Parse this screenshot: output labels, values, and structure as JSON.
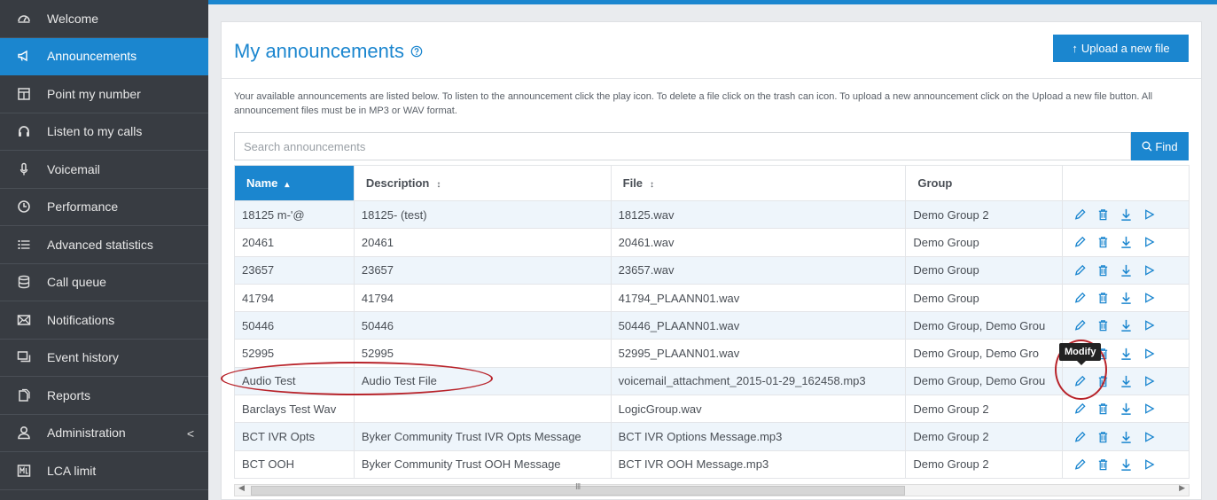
{
  "sidebar": {
    "items": [
      {
        "label": "Welcome",
        "icon": "dashboard-icon"
      },
      {
        "label": "Announcements",
        "icon": "megaphone-icon",
        "active": true
      },
      {
        "label": "Point my number",
        "icon": "layout-icon"
      },
      {
        "label": "Listen to my calls",
        "icon": "headset-icon"
      },
      {
        "label": "Voicemail",
        "icon": "microphone-icon"
      },
      {
        "label": "Performance",
        "icon": "clock-icon"
      },
      {
        "label": "Advanced statistics",
        "icon": "list-icon"
      },
      {
        "label": "Call queue",
        "icon": "database-icon"
      },
      {
        "label": "Notifications",
        "icon": "envelope-icon"
      },
      {
        "label": "Event history",
        "icon": "history-icon"
      },
      {
        "label": "Reports",
        "icon": "copy-icon"
      },
      {
        "label": "Administration",
        "icon": "user-icon",
        "chevron": "<"
      },
      {
        "label": "LCA limit",
        "icon": "limit-icon"
      }
    ]
  },
  "page": {
    "title": "My announcements",
    "upload_label": "Upload a new file",
    "intro": "Your available announcements are listed below. To listen to the announcement click the play icon. To delete a file click on the trash can icon. To upload a new announcement click on the Upload a new file button. All announcement files must be in MP3 or WAV format.",
    "search_placeholder": "Search announcements",
    "find_label": "Find"
  },
  "table": {
    "columns": [
      "Name",
      "Description",
      "File",
      "Group",
      ""
    ],
    "sort_markers": [
      "▴",
      "↕",
      "↕",
      "",
      ""
    ],
    "rows": [
      [
        "18125 m-'@",
        "18125- (test)",
        "18125.wav",
        "Demo Group 2"
      ],
      [
        "20461",
        "20461",
        "20461.wav",
        "Demo Group"
      ],
      [
        "23657",
        "23657",
        "23657.wav",
        "Demo Group"
      ],
      [
        "41794",
        "41794",
        "41794_PLAANN01.wav",
        "Demo Group"
      ],
      [
        "50446",
        "50446",
        "50446_PLAANN01.wav",
        "Demo Group, Demo Grou"
      ],
      [
        "52995",
        "52995",
        "52995_PLAANN01.wav",
        "Demo Group, Demo Gro"
      ],
      [
        "Audio Test",
        "Audio Test File",
        "voicemail_attachment_2015-01-29_162458.mp3",
        "Demo Group, Demo Grou"
      ],
      [
        "Barclays Test Wav",
        "",
        "LogicGroup.wav",
        "Demo Group 2"
      ],
      [
        "BCT IVR Opts",
        "Byker Community Trust IVR Opts Message",
        "BCT IVR Options Message.mp3",
        "Demo Group 2"
      ],
      [
        "BCT OOH",
        "Byker Community Trust OOH Message",
        "BCT IVR OOH Message.mp3",
        "Demo Group 2"
      ]
    ]
  },
  "tooltip": {
    "label": "Modify"
  },
  "scrollbar": {
    "grip": "III"
  },
  "colors": {
    "accent": "#1b86cf",
    "sidebar": "#383c42",
    "annotation": "#b8232a"
  }
}
